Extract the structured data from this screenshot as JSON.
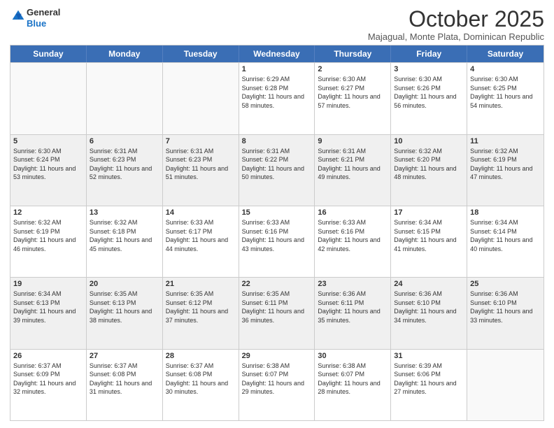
{
  "logo": {
    "general": "General",
    "blue": "Blue"
  },
  "header": {
    "month": "October 2025",
    "location": "Majagual, Monte Plata, Dominican Republic"
  },
  "weekdays": [
    "Sunday",
    "Monday",
    "Tuesday",
    "Wednesday",
    "Thursday",
    "Friday",
    "Saturday"
  ],
  "weeks": [
    [
      {
        "day": "",
        "empty": true
      },
      {
        "day": "",
        "empty": true
      },
      {
        "day": "",
        "empty": true
      },
      {
        "day": "1",
        "sunrise": "6:29 AM",
        "sunset": "6:28 PM",
        "daylight": "11 hours and 58 minutes."
      },
      {
        "day": "2",
        "sunrise": "6:30 AM",
        "sunset": "6:27 PM",
        "daylight": "11 hours and 57 minutes."
      },
      {
        "day": "3",
        "sunrise": "6:30 AM",
        "sunset": "6:26 PM",
        "daylight": "11 hours and 56 minutes."
      },
      {
        "day": "4",
        "sunrise": "6:30 AM",
        "sunset": "6:25 PM",
        "daylight": "11 hours and 54 minutes."
      }
    ],
    [
      {
        "day": "5",
        "sunrise": "6:30 AM",
        "sunset": "6:24 PM",
        "daylight": "11 hours and 53 minutes."
      },
      {
        "day": "6",
        "sunrise": "6:31 AM",
        "sunset": "6:23 PM",
        "daylight": "11 hours and 52 minutes."
      },
      {
        "day": "7",
        "sunrise": "6:31 AM",
        "sunset": "6:23 PM",
        "daylight": "11 hours and 51 minutes."
      },
      {
        "day": "8",
        "sunrise": "6:31 AM",
        "sunset": "6:22 PM",
        "daylight": "11 hours and 50 minutes."
      },
      {
        "day": "9",
        "sunrise": "6:31 AM",
        "sunset": "6:21 PM",
        "daylight": "11 hours and 49 minutes."
      },
      {
        "day": "10",
        "sunrise": "6:32 AM",
        "sunset": "6:20 PM",
        "daylight": "11 hours and 48 minutes."
      },
      {
        "day": "11",
        "sunrise": "6:32 AM",
        "sunset": "6:19 PM",
        "daylight": "11 hours and 47 minutes."
      }
    ],
    [
      {
        "day": "12",
        "sunrise": "6:32 AM",
        "sunset": "6:19 PM",
        "daylight": "11 hours and 46 minutes."
      },
      {
        "day": "13",
        "sunrise": "6:32 AM",
        "sunset": "6:18 PM",
        "daylight": "11 hours and 45 minutes."
      },
      {
        "day": "14",
        "sunrise": "6:33 AM",
        "sunset": "6:17 PM",
        "daylight": "11 hours and 44 minutes."
      },
      {
        "day": "15",
        "sunrise": "6:33 AM",
        "sunset": "6:16 PM",
        "daylight": "11 hours and 43 minutes."
      },
      {
        "day": "16",
        "sunrise": "6:33 AM",
        "sunset": "6:16 PM",
        "daylight": "11 hours and 42 minutes."
      },
      {
        "day": "17",
        "sunrise": "6:34 AM",
        "sunset": "6:15 PM",
        "daylight": "11 hours and 41 minutes."
      },
      {
        "day": "18",
        "sunrise": "6:34 AM",
        "sunset": "6:14 PM",
        "daylight": "11 hours and 40 minutes."
      }
    ],
    [
      {
        "day": "19",
        "sunrise": "6:34 AM",
        "sunset": "6:13 PM",
        "daylight": "11 hours and 39 minutes."
      },
      {
        "day": "20",
        "sunrise": "6:35 AM",
        "sunset": "6:13 PM",
        "daylight": "11 hours and 38 minutes."
      },
      {
        "day": "21",
        "sunrise": "6:35 AM",
        "sunset": "6:12 PM",
        "daylight": "11 hours and 37 minutes."
      },
      {
        "day": "22",
        "sunrise": "6:35 AM",
        "sunset": "6:11 PM",
        "daylight": "11 hours and 36 minutes."
      },
      {
        "day": "23",
        "sunrise": "6:36 AM",
        "sunset": "6:11 PM",
        "daylight": "11 hours and 35 minutes."
      },
      {
        "day": "24",
        "sunrise": "6:36 AM",
        "sunset": "6:10 PM",
        "daylight": "11 hours and 34 minutes."
      },
      {
        "day": "25",
        "sunrise": "6:36 AM",
        "sunset": "6:10 PM",
        "daylight": "11 hours and 33 minutes."
      }
    ],
    [
      {
        "day": "26",
        "sunrise": "6:37 AM",
        "sunset": "6:09 PM",
        "daylight": "11 hours and 32 minutes."
      },
      {
        "day": "27",
        "sunrise": "6:37 AM",
        "sunset": "6:08 PM",
        "daylight": "11 hours and 31 minutes."
      },
      {
        "day": "28",
        "sunrise": "6:37 AM",
        "sunset": "6:08 PM",
        "daylight": "11 hours and 30 minutes."
      },
      {
        "day": "29",
        "sunrise": "6:38 AM",
        "sunset": "6:07 PM",
        "daylight": "11 hours and 29 minutes."
      },
      {
        "day": "30",
        "sunrise": "6:38 AM",
        "sunset": "6:07 PM",
        "daylight": "11 hours and 28 minutes."
      },
      {
        "day": "31",
        "sunrise": "6:39 AM",
        "sunset": "6:06 PM",
        "daylight": "11 hours and 27 minutes."
      },
      {
        "day": "",
        "empty": true
      }
    ]
  ]
}
